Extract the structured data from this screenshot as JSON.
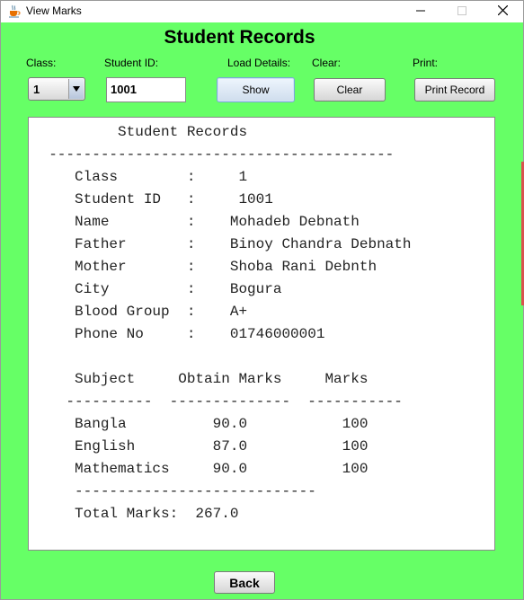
{
  "window": {
    "title": "View Marks"
  },
  "heading": "Student Records",
  "form": {
    "class_label": "Class:",
    "class_value": "1",
    "student_id_label": "Student ID:",
    "student_id_value": "1001",
    "load_label": "Load Details:",
    "show_button": "Show",
    "clear_label": "Clear:",
    "clear_button": "Clear",
    "print_label": "Print:",
    "print_button": "Print Record"
  },
  "record": {
    "text": "          Student Records\n  ----------------------------------------\n     Class        :     1\n     Student ID   :     1001\n     Name         :    Mohadeb Debnath\n     Father       :    Binoy Chandra Debnath\n     Mother       :    Shoba Rani Debnth\n     City         :    Bogura\n     Blood Group  :    A+\n     Phone No     :    01746000001\n\n     Subject     Obtain Marks     Marks\n    ----------  --------------  -----------\n     Bangla          90.0           100\n     English         87.0           100\n     Mathematics     90.0           100\n     ----------------------------\n     Total Marks:  267.0"
  },
  "back_button": "Back",
  "icons": {
    "app": "java-cup-icon",
    "minimize": "minimize-icon",
    "maximize": "maximize-icon",
    "close": "close-icon",
    "dropdown": "triangle-down-icon"
  },
  "colors": {
    "background": "#66ff66",
    "record_area": "#ffffff"
  }
}
